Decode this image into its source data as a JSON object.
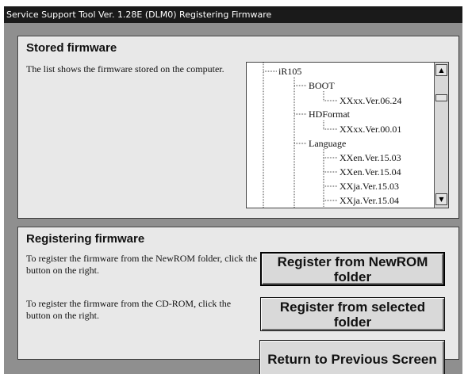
{
  "window": {
    "title": "Service Support Tool Ver. 1.28E (DLM0)   Registering Firmware"
  },
  "stored": {
    "title": "Stored firmware",
    "description": "The list shows the firmware stored on the computer.",
    "tree": [
      {
        "label": "iR105"
      },
      {
        "label": "BOOT"
      },
      {
        "label": "XXxx.Ver.06.24"
      },
      {
        "label": "HDFormat"
      },
      {
        "label": "XXxx.Ver.00.01"
      },
      {
        "label": "Language"
      },
      {
        "label": "XXen.Ver.15.03"
      },
      {
        "label": "XXen.Ver.15.04"
      },
      {
        "label": "XXja.Ver.15.03"
      },
      {
        "label": "XXja.Ver.15.04"
      }
    ],
    "scroll_up": "▲",
    "scroll_down": "▼"
  },
  "registering": {
    "title": "Registering firmware",
    "newrom_text": "To register the firmware from the NewROM folder, click the button on the right.",
    "cdrom_text": "To register the firmware from the CD-ROM, click the button on the right.",
    "newrom_button": "Register from NewROM folder",
    "selected_button": "Register from selected folder"
  },
  "return_button": "Return to Previous Screen"
}
